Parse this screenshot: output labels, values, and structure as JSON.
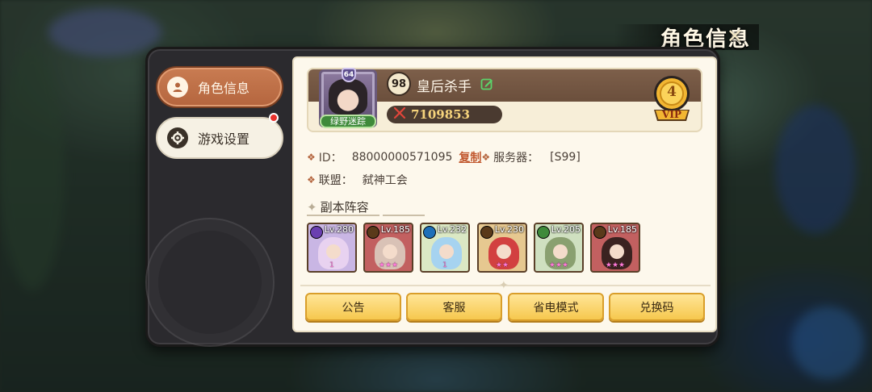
{
  "header": {
    "title": "角色信息",
    "close_icon": "close-x-icon"
  },
  "sidebar": {
    "tabs": [
      {
        "label": "角色信息",
        "icon": "user-icon",
        "active": true
      },
      {
        "label": "游戏设置",
        "icon": "gear-icon",
        "active": false,
        "badge": true
      }
    ]
  },
  "profile": {
    "avatar_level": "64",
    "avatar_tag": "绿野迷踪",
    "level": "98",
    "name": "皇后杀手",
    "power": "7109853",
    "vip": "4",
    "vip_label": "VIP"
  },
  "info": {
    "id_label": "ID：",
    "id_value": "88000000571095",
    "copy_label": "复制",
    "server_label": "服务器：",
    "server_value": "[S99]",
    "guild_label": "联盟：",
    "guild_value": "弑神工会"
  },
  "lineup": {
    "title": "副本阵容",
    "heroes": [
      {
        "level": "Lv.280",
        "element_color": "#6a3fb0",
        "bg": "#c9b6e4",
        "skin": "#e8d2f0",
        "stars": "1"
      },
      {
        "level": "Lv.185",
        "element_color": "#5a3a1a",
        "bg": "#c26060",
        "skin": "#d9c2b6",
        "stars": "★★★"
      },
      {
        "level": "Lv.232",
        "element_color": "#1e6fb8",
        "bg": "#dbe8c4",
        "skin": "#a6d3f0",
        "stars": "1"
      },
      {
        "level": "Lv.230",
        "element_color": "#5a3a1a",
        "bg": "#e6c890",
        "skin": "#d24040",
        "stars": "★★"
      },
      {
        "level": "Lv.205",
        "element_color": "#3e8a3a",
        "bg": "#cfe0c0",
        "skin": "#8aa070",
        "stars": "★★★"
      },
      {
        "level": "Lv.185",
        "element_color": "#5a3a1a",
        "bg": "#c26060",
        "skin": "#3a2220",
        "stars": "★★★"
      }
    ]
  },
  "buttons": {
    "notice": "公告",
    "service": "客服",
    "power_save": "省电模式",
    "redeem": "兑换码"
  },
  "colors": {
    "accent": "#b4653e",
    "button": "#f6c84e",
    "card": "#fdf8ec"
  }
}
